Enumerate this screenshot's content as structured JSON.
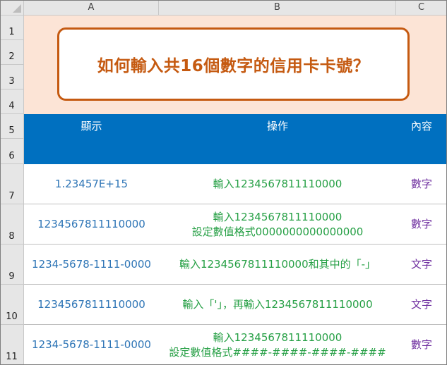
{
  "columns": [
    "A",
    "B",
    "C"
  ],
  "rows": [
    "1",
    "2",
    "3",
    "4",
    "5",
    "6",
    "7",
    "8",
    "9",
    "10",
    "11"
  ],
  "title": "如何輸入共16個數字的信用卡卡號？",
  "headers": {
    "display": "顯示",
    "operation": "操作",
    "content": "內容"
  },
  "data_rows": [
    {
      "display": "1.23457E+15",
      "operation": [
        "輸入1234567811110000"
      ],
      "content": "數字"
    },
    {
      "display": "1234567811110000",
      "operation": [
        "輸入1234567811110000",
        "設定數值格式0000000000000000"
      ],
      "content": "數字"
    },
    {
      "display": "1234-5678-1111-0000",
      "operation": [
        "輸入1234567811110000和其中的「-」"
      ],
      "content": "文字"
    },
    {
      "display": "1234567811110000",
      "operation": [
        "輸入「'」，再輸入1234567811110000"
      ],
      "content": "文字"
    },
    {
      "display": "1234-5678-1111-0000",
      "operation": [
        "輸入1234567811110000",
        "設定數值格式####-####-####-####"
      ],
      "content": "數字"
    }
  ],
  "colors": {
    "title_band": "#fce4d6",
    "title_accent": "#c55a11",
    "header_band": "#0070c0",
    "display_text": "#2e75b6",
    "operation_text": "#27a046",
    "content_text": "#7030a0"
  }
}
